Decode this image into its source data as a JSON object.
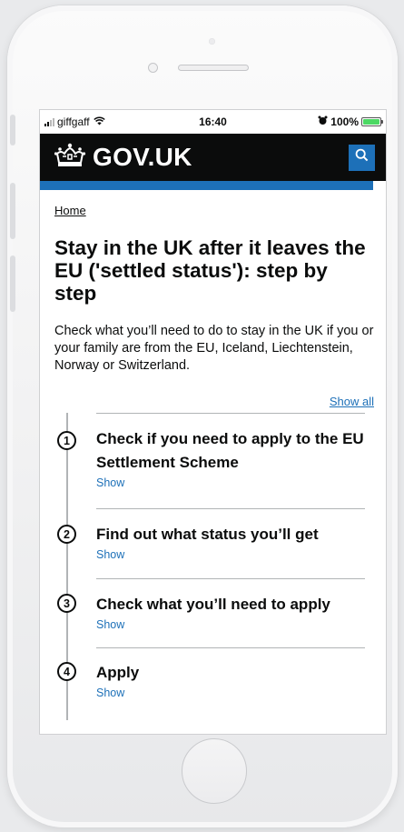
{
  "status_bar": {
    "carrier": "giffgaff",
    "time": "16:40",
    "battery_percent": "100%",
    "icons": [
      "signal-icon",
      "wifi-icon",
      "alarm-icon",
      "battery-charging-icon"
    ]
  },
  "header": {
    "logo_text": "GOV.UK",
    "icons": [
      "crown-icon",
      "search-icon"
    ],
    "colors": {
      "header_bg": "#0b0c0c",
      "accent_blue": "#1d70b8"
    }
  },
  "breadcrumb": {
    "home_label": "Home"
  },
  "page": {
    "title": "Stay in the UK after it leaves the EU ('settled status'): step by step",
    "lead": "Check what you’ll need to do to stay in the UK if you or your family are from the EU, Iceland, Liechtenstein, Norway or Switzerland."
  },
  "step_nav": {
    "show_all_label": "Show all",
    "steps": [
      {
        "number": "1",
        "title": "Check if you need to apply to the EU Settlement Scheme",
        "toggle_label": "Show"
      },
      {
        "number": "2",
        "title": "Find out what status you’ll get",
        "toggle_label": "Show"
      },
      {
        "number": "3",
        "title": "Check what you’ll need to apply",
        "toggle_label": "Show"
      },
      {
        "number": "4",
        "title": "Apply",
        "toggle_label": "Show"
      }
    ]
  }
}
